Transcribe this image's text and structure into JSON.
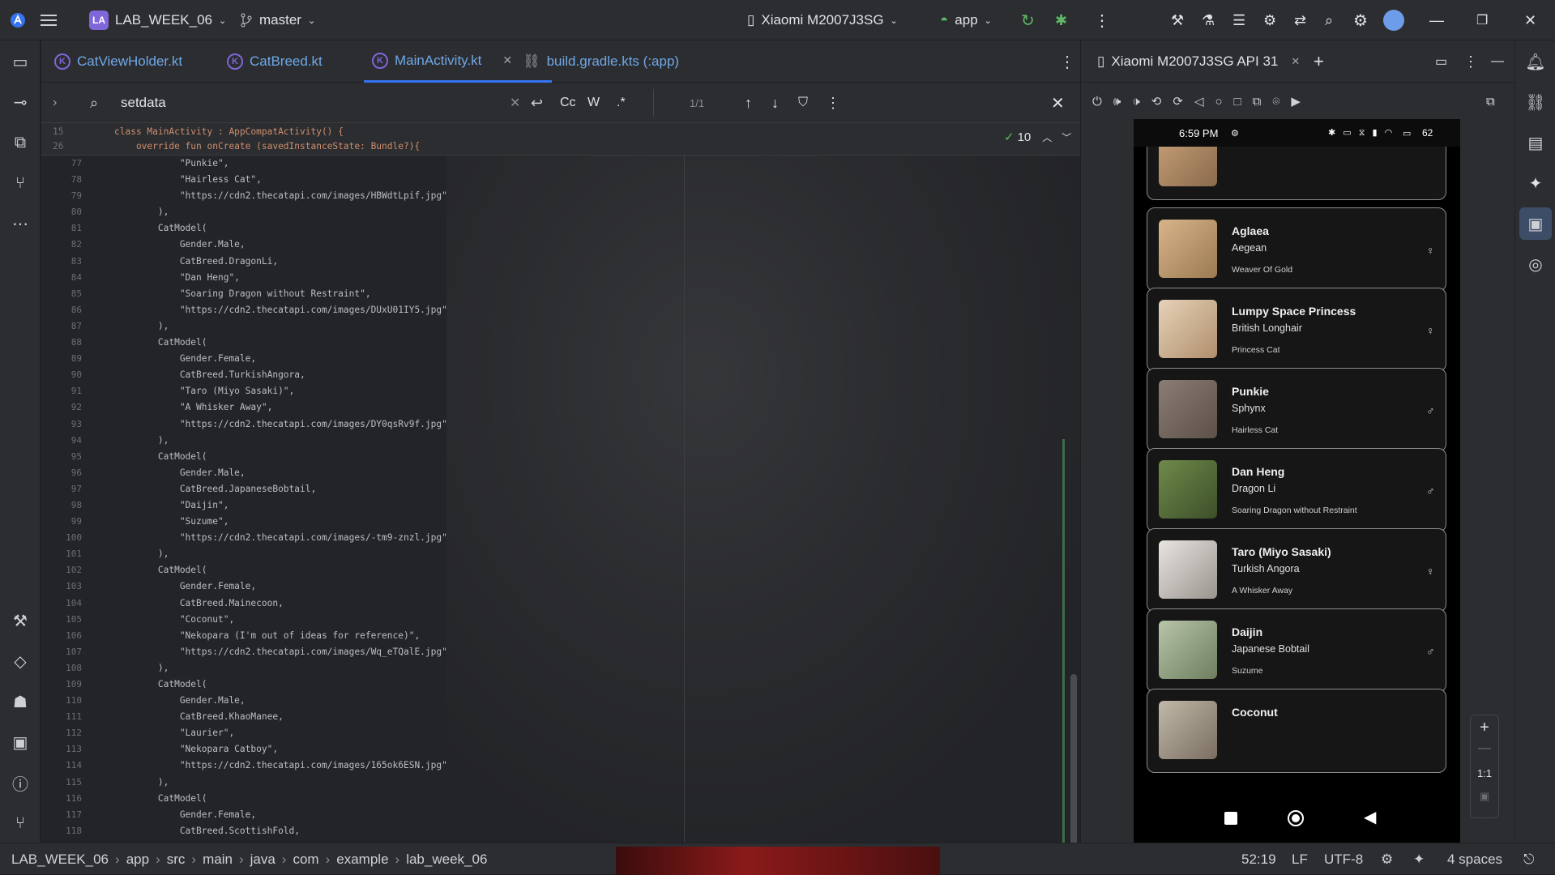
{
  "titlebar": {
    "project_badge": "LA",
    "project_name": "LAB_WEEK_06",
    "branch": "master",
    "device": "Xiaomi M2007J3SG",
    "run_config": "app"
  },
  "tabs": [
    {
      "label": "CatViewHolder.kt"
    },
    {
      "label": "CatBreed.kt"
    },
    {
      "label": "MainActivity.kt"
    },
    {
      "label": "build.gradle.kts (:app)"
    }
  ],
  "search": {
    "query": "setdata",
    "match_count": "1/1",
    "case_label": "Cc",
    "word_label": "W",
    "regex_label": ".*"
  },
  "editor": {
    "sticky_lines": [
      {
        "num": "15",
        "text": "class MainActivity : AppCompatActivity() {"
      },
      {
        "num": "26",
        "text": "    override fun onCreate (savedInstanceState: Bundle?){"
      }
    ],
    "check_count": "10",
    "lines": [
      {
        "num": "77",
        "t": "            \"Punkie\","
      },
      {
        "num": "78",
        "t": "            \"Hairless Cat\","
      },
      {
        "num": "79",
        "t": "            \"https://cdn2.thecatapi.com/images/HBWdtLpif.jpg\""
      },
      {
        "num": "80",
        "t": "        ),"
      },
      {
        "num": "81",
        "t": "        CatModel("
      },
      {
        "num": "82",
        "t": "            Gender.Male,"
      },
      {
        "num": "83",
        "t": "            CatBreed.DragonLi,"
      },
      {
        "num": "84",
        "t": "            \"Dan Heng\","
      },
      {
        "num": "85",
        "t": "            \"Soaring Dragon without Restraint\","
      },
      {
        "num": "86",
        "t": "            \"https://cdn2.thecatapi.com/images/DUxU01IY5.jpg\""
      },
      {
        "num": "87",
        "t": "        ),"
      },
      {
        "num": "88",
        "t": "        CatModel("
      },
      {
        "num": "89",
        "t": "            Gender.Female,"
      },
      {
        "num": "90",
        "t": "            CatBreed.TurkishAngora,"
      },
      {
        "num": "91",
        "t": "            \"Taro (Miyo Sasaki)\","
      },
      {
        "num": "92",
        "t": "            \"A Whisker Away\","
      },
      {
        "num": "93",
        "t": "            \"https://cdn2.thecatapi.com/images/DY0qsRv9f.jpg\""
      },
      {
        "num": "94",
        "t": "        ),"
      },
      {
        "num": "95",
        "t": "        CatModel("
      },
      {
        "num": "96",
        "t": "            Gender.Male,"
      },
      {
        "num": "97",
        "t": "            CatBreed.JapaneseBobtail,"
      },
      {
        "num": "98",
        "t": "            \"Daijin\","
      },
      {
        "num": "99",
        "t": "            \"Suzume\","
      },
      {
        "num": "100",
        "t": "            \"https://cdn2.thecatapi.com/images/-tm9-znzl.jpg\""
      },
      {
        "num": "101",
        "t": "        ),"
      },
      {
        "num": "102",
        "t": "        CatModel("
      },
      {
        "num": "103",
        "t": "            Gender.Female,"
      },
      {
        "num": "104",
        "t": "            CatBreed.Mainecoon,"
      },
      {
        "num": "105",
        "t": "            \"Coconut\","
      },
      {
        "num": "106",
        "t": "            \"Nekopara (I'm out of ideas for reference)\","
      },
      {
        "num": "107",
        "t": "            \"https://cdn2.thecatapi.com/images/Wq_eTQalE.jpg\""
      },
      {
        "num": "108",
        "t": "        ),"
      },
      {
        "num": "109",
        "t": "        CatModel("
      },
      {
        "num": "110",
        "t": "            Gender.Male,"
      },
      {
        "num": "111",
        "t": "            CatBreed.KhaoManee,"
      },
      {
        "num": "112",
        "t": "            \"Laurier\","
      },
      {
        "num": "113",
        "t": "            \"Nekopara Catboy\","
      },
      {
        "num": "114",
        "t": "            \"https://cdn2.thecatapi.com/images/165ok6ESN.jpg\""
      },
      {
        "num": "115",
        "t": "        ),"
      },
      {
        "num": "116",
        "t": "        CatModel("
      },
      {
        "num": "117",
        "t": "            Gender.Female,"
      },
      {
        "num": "118",
        "t": "            CatBreed.ScottishFold,"
      }
    ]
  },
  "emulator": {
    "tab_label": "Xiaomi M2007J3SG API 31",
    "status_time": "6:59 PM",
    "battery": "62",
    "cards": [
      {
        "name": "Aglaea",
        "breed": "Aegean",
        "desc": "Weaver Of Gold",
        "gender": "♀"
      },
      {
        "name": "Lumpy Space Princess",
        "breed": "British Longhair",
        "desc": "Princess Cat",
        "gender": "♀"
      },
      {
        "name": "Punkie",
        "breed": "Sphynx",
        "desc": "Hairless Cat",
        "gender": "♂"
      },
      {
        "name": "Dan Heng",
        "breed": "Dragon Li",
        "desc": "Soaring Dragon without Restraint",
        "gender": "♂"
      },
      {
        "name": "Taro (Miyo Sasaki)",
        "breed": "Turkish Angora",
        "desc": "A Whisker Away",
        "gender": "♀"
      },
      {
        "name": "Daijin",
        "breed": "Japanese Bobtail",
        "desc": "Suzume",
        "gender": "♂"
      },
      {
        "name": "Coconut",
        "breed": "",
        "desc": "",
        "gender": ""
      }
    ],
    "zoom_label": "1:1"
  },
  "statusbar": {
    "breadcrumbs": [
      "LAB_WEEK_06",
      "app",
      "src",
      "main",
      "java",
      "com",
      "example",
      "lab_week_06"
    ],
    "position": "52:19",
    "line_sep": "LF",
    "encoding": "UTF-8",
    "indent": "4 spaces"
  },
  "colors": {
    "accent": "#3574f0",
    "string": "#6aab73",
    "keyword": "#cf8e6d"
  }
}
